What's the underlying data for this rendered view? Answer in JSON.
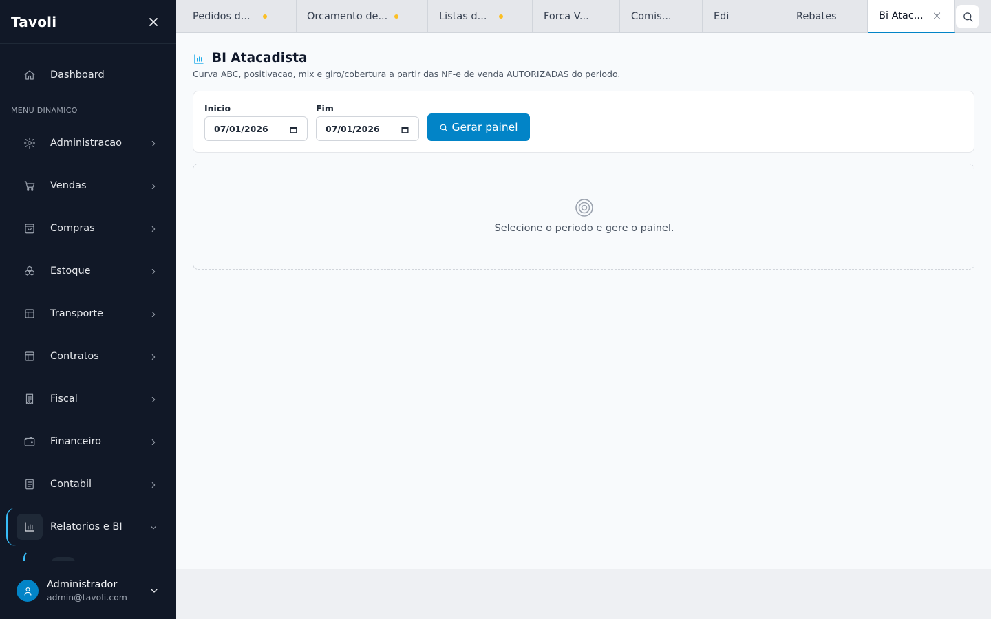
{
  "sidebar": {
    "brand": "Tavoli",
    "section_label": "MENU DINAMICO",
    "dashboard": {
      "label": "Dashboard",
      "icon": "home-icon"
    },
    "items": [
      {
        "label": "Administracao",
        "icon": "gear-icon"
      },
      {
        "label": "Vendas",
        "icon": "cart-icon"
      },
      {
        "label": "Compras",
        "icon": "shopping-bag-icon"
      },
      {
        "label": "Estoque",
        "icon": "boxes-icon"
      },
      {
        "label": "Transporte",
        "icon": "layout-icon"
      },
      {
        "label": "Contratos",
        "icon": "layout-icon"
      },
      {
        "label": "Fiscal",
        "icon": "receipt-icon"
      },
      {
        "label": "Financeiro",
        "icon": "wallet-icon"
      },
      {
        "label": "Contabil",
        "icon": "ledger-icon"
      },
      {
        "label": "Relatorios e BI",
        "icon": "bar-chart-icon",
        "expanded": true
      }
    ],
    "user": {
      "name": "Administrador",
      "email": "admin@tavoli.com"
    }
  },
  "tabs": [
    {
      "label": "Pedidos d...",
      "unsaved": true
    },
    {
      "label": "Orcamento de...",
      "unsaved": true
    },
    {
      "label": "Listas d...",
      "unsaved": true
    },
    {
      "label": "Forca V...",
      "unsaved": false
    },
    {
      "label": "Comis...",
      "unsaved": false
    },
    {
      "label": "Edi",
      "unsaved": false
    },
    {
      "label": "Rebates",
      "unsaved": false
    },
    {
      "label": "Bi Atac...",
      "active": true
    }
  ],
  "page": {
    "title": "BI Atacadista",
    "subtitle": "Curva ABC, positivacao, mix e giro/cobertura a partir das NF-e de venda AUTORIZADAS do periodo.",
    "filters": {
      "start_label": "Inicio",
      "start_value": "07/01/2026",
      "end_label": "Fim",
      "end_value": "07/01/2026",
      "submit_label": "Gerar painel"
    },
    "empty_state": "Selecione o periodo e gere o painel."
  },
  "colors": {
    "sidebar_bg": "#111827",
    "accent": "#0284c7",
    "active_indicator": "#38bdf8",
    "unsaved_dot": "#fbbf24"
  }
}
